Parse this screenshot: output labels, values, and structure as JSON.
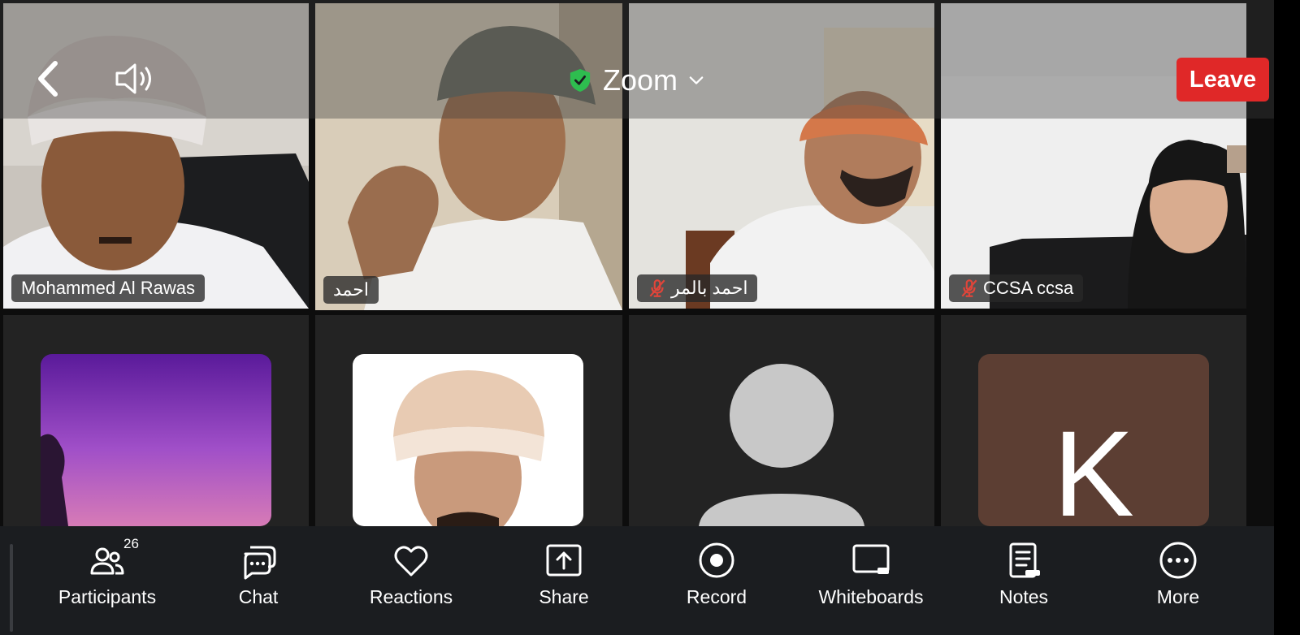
{
  "header": {
    "meeting_title": "Zoom",
    "leave_label": "Leave"
  },
  "participants": {
    "row1": [
      {
        "name": "Mohammed Al Rawas",
        "muted": false
      },
      {
        "name": "احمد",
        "muted": false,
        "active_speaker": true
      },
      {
        "name": "احمد بالمر",
        "muted": true
      },
      {
        "name": "CCSA ccsa",
        "muted": true
      }
    ],
    "row2": [
      {
        "avatar": "purple-sky-photo"
      },
      {
        "avatar": "profile-photo"
      },
      {
        "avatar": "default-silhouette"
      },
      {
        "avatar_letter": "K"
      }
    ]
  },
  "toolbar": {
    "participants_label": "Participants",
    "participants_count": "26",
    "chat_label": "Chat",
    "reactions_label": "Reactions",
    "share_label": "Share",
    "record_label": "Record",
    "whiteboards_label": "Whiteboards",
    "notes_label": "Notes",
    "more_label": "More"
  },
  "colors": {
    "leave_button": "#e02828",
    "active_speaker_border": "#2ebd4f",
    "toolbar_bg": "#1b1d20",
    "secure_shield": "#2ebd4f",
    "muted_mic": "#e0453a",
    "letter_avatar_bg": "#5c3e33"
  }
}
